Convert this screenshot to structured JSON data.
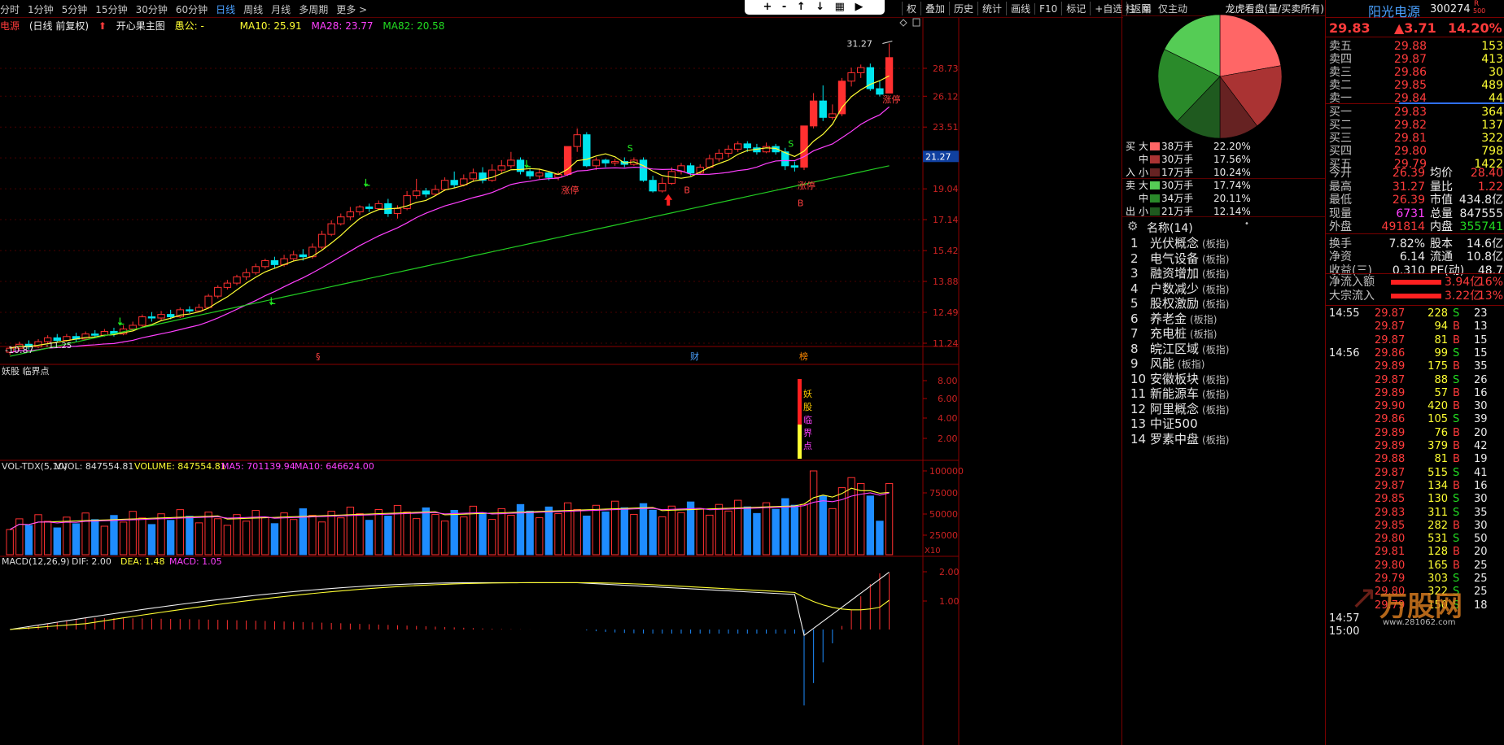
{
  "periods": [
    "分时",
    "1分钟",
    "5分钟",
    "15分钟",
    "30分钟",
    "60分钟",
    "日线",
    "周线",
    "月线",
    "多周期",
    "更多 >"
  ],
  "selected_period": "日线",
  "center_controls": "+ - ↑ ↓ ▦ ▶",
  "toolbar": [
    "权",
    "叠加",
    "历史",
    "统计",
    "画线",
    "F10",
    "标记",
    "+自选",
    "返回"
  ],
  "chart_header": {
    "name": "电源",
    "mode": "(日线 前复权)",
    "main_indicator": "开心果主图",
    "extra": "愚公: -",
    "ma10": "MA10: 25.91",
    "ma28": "MA28: 23.77",
    "ma82": "MA82: 20.58"
  },
  "price_axis": [
    "28.73",
    "26.12",
    "23.51",
    "21.16",
    "19.04",
    "17.14",
    "15.42",
    "13.88",
    "12.49",
    "11.24"
  ],
  "last_price_tag": "21.27",
  "high_tag": "31.27",
  "low_tag": "-10.87",
  "low_tag2": "-11.25",
  "candle_labels": {
    "zt1": "涨停",
    "zt2": "涨停",
    "zt3": "涨停",
    "b1": "B",
    "b2": "B",
    "s1": "S",
    "s2": "S"
  },
  "event_marks": [
    "§",
    "财",
    "榜"
  ],
  "sub1": {
    "title": "妖股 临界点",
    "axis": [
      "8.00",
      "6.00",
      "4.00",
      "2.00"
    ],
    "vertical_text": [
      "妖",
      "股",
      "临",
      "界",
      "点"
    ]
  },
  "vol": {
    "title": "VOL-TDX(5,10)",
    "vvol": "VVOL: 847554.81",
    "volume": "VOLUME: 847554.81",
    "ma5": "MA5: 701139.94",
    "ma10": "MA10: 646624.00",
    "axis": [
      "100000",
      "75000",
      "50000",
      "25000"
    ],
    "unit": "X10"
  },
  "macd": {
    "title": "MACD(12,26,9)",
    "dif": "DIF: 2.00",
    "dea": "DEA: 1.48",
    "macd": "MACD: 1.05",
    "axis": [
      "2.00",
      "1.00"
    ]
  },
  "mid": {
    "tabs": [
      "柱",
      "单",
      "仅主动"
    ],
    "title": "龙虎看盘(量/买卖所有)",
    "flows": [
      {
        "side": "买",
        "size": "大",
        "amt": "38万手",
        "pct": "22.20%",
        "color": "#ff6666"
      },
      {
        "side": "",
        "size": "中",
        "amt": "30万手",
        "pct": "17.56%",
        "color": "#aa3333"
      },
      {
        "side": "入",
        "size": "小",
        "amt": "17万手",
        "pct": "10.24%",
        "color": "#662222"
      },
      {
        "side": "卖",
        "size": "大",
        "amt": "30万手",
        "pct": "17.74%",
        "color": "#55cc55"
      },
      {
        "side": "",
        "size": "中",
        "amt": "34万手",
        "pct": "20.11%",
        "color": "#2a8a2a"
      },
      {
        "side": "出",
        "size": "小",
        "amt": "21万手",
        "pct": "12.14%",
        "color": "#1f5a1f"
      }
    ],
    "concepts_title": "名称(14)",
    "concepts": [
      {
        "n": "1",
        "t": "光伏概念",
        "s": "(板指)"
      },
      {
        "n": "2",
        "t": "电气设备",
        "s": "(板指)"
      },
      {
        "n": "3",
        "t": "融资增加",
        "s": "(板指)"
      },
      {
        "n": "4",
        "t": "户数减少",
        "s": "(板指)"
      },
      {
        "n": "5",
        "t": "股权激励",
        "s": "(板指)"
      },
      {
        "n": "6",
        "t": "养老金",
        "s": "(板指)"
      },
      {
        "n": "7",
        "t": "充电桩",
        "s": "(板指)"
      },
      {
        "n": "8",
        "t": "皖江区域",
        "s": "(板指)"
      },
      {
        "n": "9",
        "t": "风能",
        "s": "(板指)"
      },
      {
        "n": "10",
        "t": "安徽板块",
        "s": "(板指)"
      },
      {
        "n": "11",
        "t": "新能源车",
        "s": "(板指)"
      },
      {
        "n": "12",
        "t": "阿里概念",
        "s": "(板指)"
      },
      {
        "n": "13",
        "t": "中证500",
        "s": ""
      },
      {
        "n": "14",
        "t": "罗素中盘",
        "s": "(板指)"
      }
    ]
  },
  "quote": {
    "name": "阳光电源",
    "code": "300274",
    "tag": "R",
    "tag2": "500",
    "price": "29.83",
    "change": "▲3.71",
    "pct": "14.20%",
    "asks": [
      {
        "l": "卖五",
        "p": "29.88",
        "v": "153"
      },
      {
        "l": "卖四",
        "p": "29.87",
        "v": "413"
      },
      {
        "l": "卖三",
        "p": "29.86",
        "v": "30"
      },
      {
        "l": "卖二",
        "p": "29.85",
        "v": "489"
      },
      {
        "l": "卖一",
        "p": "29.84",
        "v": "44"
      }
    ],
    "bids": [
      {
        "l": "买一",
        "p": "29.83",
        "v": "364"
      },
      {
        "l": "买二",
        "p": "29.82",
        "v": "137"
      },
      {
        "l": "买三",
        "p": "29.81",
        "v": "322"
      },
      {
        "l": "买四",
        "p": "29.80",
        "v": "798"
      },
      {
        "l": "买五",
        "p": "29.79",
        "v": "1422"
      }
    ],
    "stats": [
      {
        "a": "今开",
        "av": "26.39",
        "b": "均价",
        "bv": "28.40",
        "ac": "red",
        "bc": "red"
      },
      {
        "a": "最高",
        "av": "31.27",
        "b": "量比",
        "bv": "1.22",
        "ac": "red",
        "bc": "red"
      },
      {
        "a": "最低",
        "av": "26.39",
        "b": "市值",
        "bv": "434.8亿",
        "ac": "red",
        "bc": "wht"
      },
      {
        "a": "现量",
        "av": "6731",
        "b": "总量",
        "bv": "847555",
        "ac": "mag",
        "bc": "wht"
      },
      {
        "a": "外盘",
        "av": "491814",
        "b": "内盘",
        "bv": "355741",
        "ac": "red",
        "bc": "grn"
      },
      {
        "a": "换手",
        "av": "7.82%",
        "b": "股本",
        "bv": "14.6亿",
        "ac": "wht",
        "bc": "wht"
      },
      {
        "a": "净资",
        "av": "6.14",
        "b": "流通",
        "bv": "10.8亿",
        "ac": "wht",
        "bc": "wht"
      },
      {
        "a": "收益(三)",
        "av": "0.310",
        "b": "PE(动)",
        "bv": "48.7",
        "ac": "wht",
        "bc": "wht"
      }
    ],
    "netflow": [
      {
        "l": "净流入额",
        "v": "3.94亿",
        "p": "16%"
      },
      {
        "l": "大宗流入",
        "v": "3.22亿",
        "p": "13%"
      }
    ],
    "ticks": [
      {
        "t": "14:55",
        "p": "29.87",
        "v": "228",
        "d": "S",
        "n": "23"
      },
      {
        "t": "",
        "p": "29.87",
        "v": "94",
        "d": "B",
        "n": "13"
      },
      {
        "t": "",
        "p": "29.87",
        "v": "81",
        "d": "B",
        "n": "15"
      },
      {
        "t": "14:56",
        "p": "29.86",
        "v": "99",
        "d": "S",
        "n": "15"
      },
      {
        "t": "",
        "p": "29.89",
        "v": "175",
        "d": "B",
        "n": "35"
      },
      {
        "t": "",
        "p": "29.87",
        "v": "88",
        "d": "S",
        "n": "26"
      },
      {
        "t": "",
        "p": "29.89",
        "v": "57",
        "d": "B",
        "n": "16"
      },
      {
        "t": "",
        "p": "29.90",
        "v": "420",
        "d": "B",
        "n": "30"
      },
      {
        "t": "",
        "p": "29.86",
        "v": "105",
        "d": "S",
        "n": "39"
      },
      {
        "t": "",
        "p": "29.89",
        "v": "76",
        "d": "B",
        "n": "20"
      },
      {
        "t": "",
        "p": "29.89",
        "v": "379",
        "d": "B",
        "n": "42"
      },
      {
        "t": "",
        "p": "29.88",
        "v": "81",
        "d": "B",
        "n": "19"
      },
      {
        "t": "",
        "p": "29.87",
        "v": "515",
        "d": "S",
        "n": "41"
      },
      {
        "t": "",
        "p": "29.87",
        "v": "134",
        "d": "B",
        "n": "16"
      },
      {
        "t": "",
        "p": "29.85",
        "v": "130",
        "d": "S",
        "n": "30"
      },
      {
        "t": "",
        "p": "29.83",
        "v": "311",
        "d": "S",
        "n": "35"
      },
      {
        "t": "",
        "p": "29.85",
        "v": "282",
        "d": "B",
        "n": "30"
      },
      {
        "t": "",
        "p": "29.80",
        "v": "531",
        "d": "S",
        "n": "50"
      },
      {
        "t": "",
        "p": "29.81",
        "v": "128",
        "d": "B",
        "n": "20"
      },
      {
        "t": "",
        "p": "29.80",
        "v": "165",
        "d": "B",
        "n": "25"
      },
      {
        "t": "",
        "p": "29.79",
        "v": "303",
        "d": "S",
        "n": "25"
      },
      {
        "t": "",
        "p": "29.80",
        "v": "322",
        "d": "S",
        "n": "25"
      },
      {
        "t": "",
        "p": "29.79",
        "v": "150",
        "d": "S",
        "n": "18"
      },
      {
        "t": "14:57",
        "p": "",
        "v": "",
        "d": "",
        "n": ""
      },
      {
        "t": "15:00",
        "p": "",
        "v": "",
        "d": "",
        "n": ""
      }
    ],
    "watermark": "万股网",
    "watermark_url": "www.281062.com"
  }
}
